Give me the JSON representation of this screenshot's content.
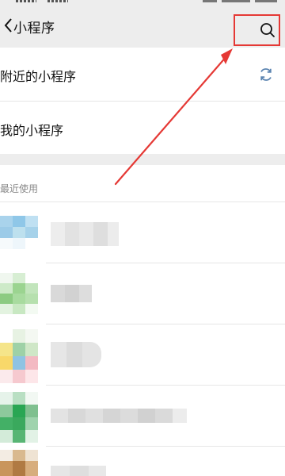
{
  "header": {
    "title": "小程序"
  },
  "rows": {
    "nearby_label": "附近的小程序",
    "mine_label": "我的小程序"
  },
  "recent": {
    "section_title": "最近使用"
  },
  "colors": {
    "header_bg": "#ededed",
    "highlight_border": "#e53935",
    "arrow": "#e53935"
  },
  "icons": [
    "back-icon",
    "search-icon",
    "refresh-icon"
  ]
}
